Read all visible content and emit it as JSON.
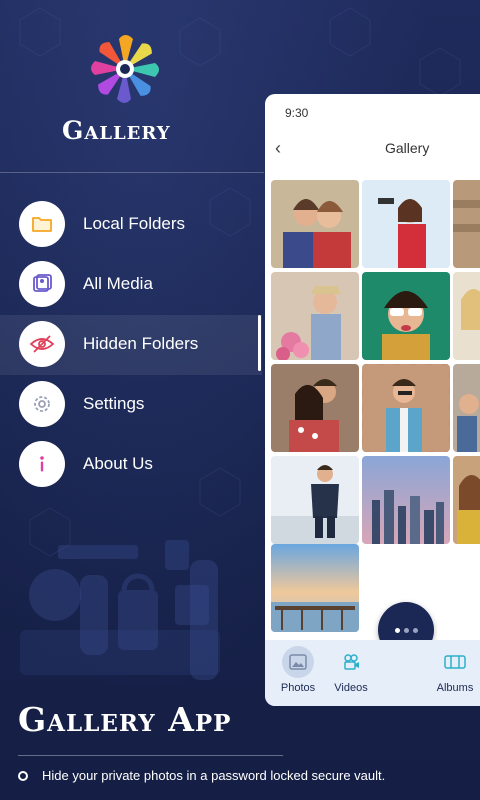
{
  "app": {
    "title": "Gallery"
  },
  "menu": {
    "items": [
      {
        "label": "Local Folders",
        "icon": "folder-icon"
      },
      {
        "label": "All Media",
        "icon": "media-icon"
      },
      {
        "label": "Hidden Folders",
        "icon": "hidden-eye-icon",
        "active": true
      },
      {
        "label": "Settings",
        "icon": "gear-icon"
      },
      {
        "label": "About Us",
        "icon": "info-icon"
      }
    ]
  },
  "phone": {
    "time": "9:30",
    "back_icon": "back-chevron-icon",
    "title": "Gallery",
    "tabs": [
      {
        "label": "Photos",
        "icon": "photo-icon",
        "active": true
      },
      {
        "label": "Videos",
        "icon": "video-camera-icon"
      },
      {
        "label": "Albums",
        "icon": "albums-icon"
      }
    ]
  },
  "promo": {
    "title": "Gallery App",
    "bullet_text": "Hide your private photos in a password locked secure vault."
  },
  "colors": {
    "background": "#1b2754",
    "accent_orange": "#f5a623",
    "accent_purple": "#6a5acd",
    "accent_red": "#e0405a",
    "accent_pink": "#e040a0",
    "tabbar": "#e6eef9"
  }
}
